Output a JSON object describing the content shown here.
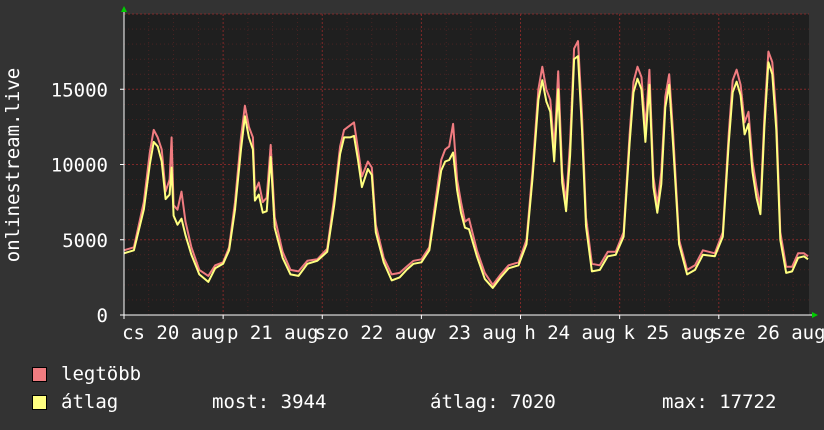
{
  "chart_data": {
    "type": "area",
    "ylabel": "onlinestream.live",
    "ylim": [
      0,
      20000
    ],
    "y_ticks": [
      "0",
      "5000",
      "10000",
      "15000"
    ],
    "x_tick_labels": [
      "cs 20 aug",
      "p 21 aug",
      "szo 22 aug",
      "v 23 aug",
      "h 24 aug",
      "k 25 aug",
      "sze 26 aug"
    ],
    "grid": true,
    "legend_placement": "bottom-left",
    "series": [
      {
        "name": "legtöbb",
        "color": "#f07c80",
        "points": [
          [
            0.0,
            4300
          ],
          [
            0.1,
            4500
          ],
          [
            0.2,
            7500
          ],
          [
            0.26,
            10800
          ],
          [
            0.3,
            12300
          ],
          [
            0.34,
            11800
          ],
          [
            0.38,
            11000
          ],
          [
            0.42,
            8200
          ],
          [
            0.46,
            9000
          ],
          [
            0.48,
            11800
          ],
          [
            0.5,
            7300
          ],
          [
            0.54,
            7000
          ],
          [
            0.58,
            8200
          ],
          [
            0.62,
            6200
          ],
          [
            0.68,
            4500
          ],
          [
            0.76,
            3000
          ],
          [
            0.85,
            2600
          ],
          [
            0.92,
            3300
          ],
          [
            1.0,
            3500
          ],
          [
            1.06,
            4500
          ],
          [
            1.12,
            7500
          ],
          [
            1.18,
            11800
          ],
          [
            1.22,
            13900
          ],
          [
            1.26,
            12500
          ],
          [
            1.3,
            11800
          ],
          [
            1.32,
            8200
          ],
          [
            1.36,
            8800
          ],
          [
            1.4,
            7500
          ],
          [
            1.44,
            7800
          ],
          [
            1.48,
            11300
          ],
          [
            1.52,
            6500
          ],
          [
            1.6,
            4200
          ],
          [
            1.68,
            3000
          ],
          [
            1.76,
            2900
          ],
          [
            1.85,
            3600
          ],
          [
            1.95,
            3700
          ],
          [
            2.05,
            4400
          ],
          [
            2.12,
            7800
          ],
          [
            2.18,
            11200
          ],
          [
            2.22,
            12300
          ],
          [
            2.28,
            12600
          ],
          [
            2.32,
            12800
          ],
          [
            2.36,
            11000
          ],
          [
            2.4,
            9200
          ],
          [
            2.46,
            10200
          ],
          [
            2.5,
            9800
          ],
          [
            2.54,
            6000
          ],
          [
            2.62,
            3800
          ],
          [
            2.7,
            2700
          ],
          [
            2.78,
            2800
          ],
          [
            2.85,
            3200
          ],
          [
            2.92,
            3600
          ],
          [
            3.0,
            3700
          ],
          [
            3.08,
            4500
          ],
          [
            3.14,
            7500
          ],
          [
            3.2,
            10300
          ],
          [
            3.24,
            11000
          ],
          [
            3.28,
            11200
          ],
          [
            3.32,
            12700
          ],
          [
            3.36,
            9000
          ],
          [
            3.4,
            7500
          ],
          [
            3.44,
            6200
          ],
          [
            3.48,
            6400
          ],
          [
            3.56,
            4300
          ],
          [
            3.64,
            2800
          ],
          [
            3.72,
            2000
          ],
          [
            3.8,
            2700
          ],
          [
            3.88,
            3300
          ],
          [
            3.98,
            3500
          ],
          [
            4.06,
            5000
          ],
          [
            4.12,
            9500
          ],
          [
            4.18,
            15000
          ],
          [
            4.22,
            16500
          ],
          [
            4.26,
            15000
          ],
          [
            4.3,
            14300
          ],
          [
            4.34,
            11000
          ],
          [
            4.38,
            16200
          ],
          [
            4.42,
            9500
          ],
          [
            4.46,
            7500
          ],
          [
            4.5,
            11500
          ],
          [
            4.54,
            17700
          ],
          [
            4.58,
            18200
          ],
          [
            4.62,
            13300
          ],
          [
            4.66,
            6500
          ],
          [
            4.72,
            3400
          ],
          [
            4.8,
            3300
          ],
          [
            4.88,
            4200
          ],
          [
            4.96,
            4200
          ],
          [
            5.04,
            5500
          ],
          [
            5.1,
            12000
          ],
          [
            5.14,
            15500
          ],
          [
            5.18,
            16500
          ],
          [
            5.22,
            15800
          ],
          [
            5.26,
            12400
          ],
          [
            5.3,
            16300
          ],
          [
            5.34,
            9200
          ],
          [
            5.38,
            7300
          ],
          [
            5.42,
            9500
          ],
          [
            5.46,
            14500
          ],
          [
            5.5,
            16000
          ],
          [
            5.54,
            12000
          ],
          [
            5.6,
            5000
          ],
          [
            5.68,
            3000
          ],
          [
            5.76,
            3300
          ],
          [
            5.84,
            4300
          ],
          [
            5.96,
            4100
          ],
          [
            6.04,
            5500
          ],
          [
            6.1,
            12000
          ],
          [
            6.14,
            15600
          ],
          [
            6.18,
            16300
          ],
          [
            6.22,
            15300
          ],
          [
            6.26,
            12800
          ],
          [
            6.3,
            13500
          ],
          [
            6.34,
            10200
          ],
          [
            6.38,
            8500
          ],
          [
            6.42,
            7200
          ],
          [
            6.46,
            13200
          ],
          [
            6.5,
            17500
          ],
          [
            6.54,
            16800
          ],
          [
            6.58,
            13200
          ],
          [
            6.62,
            5500
          ],
          [
            6.68,
            3200
          ],
          [
            6.74,
            3200
          ],
          [
            6.8,
            4100
          ],
          [
            6.86,
            4100
          ],
          [
            6.9,
            3900
          ]
        ]
      },
      {
        "name": "átlag",
        "color": "#ffff80",
        "points": [
          [
            0.0,
            4100
          ],
          [
            0.1,
            4300
          ],
          [
            0.2,
            7000
          ],
          [
            0.26,
            10000
          ],
          [
            0.3,
            11500
          ],
          [
            0.34,
            11200
          ],
          [
            0.38,
            10200
          ],
          [
            0.42,
            7700
          ],
          [
            0.46,
            8000
          ],
          [
            0.48,
            9800
          ],
          [
            0.5,
            6600
          ],
          [
            0.54,
            6000
          ],
          [
            0.58,
            6400
          ],
          [
            0.62,
            5300
          ],
          [
            0.68,
            4000
          ],
          [
            0.76,
            2700
          ],
          [
            0.85,
            2200
          ],
          [
            0.92,
            3100
          ],
          [
            1.0,
            3400
          ],
          [
            1.06,
            4300
          ],
          [
            1.12,
            7000
          ],
          [
            1.18,
            11000
          ],
          [
            1.22,
            13200
          ],
          [
            1.26,
            11800
          ],
          [
            1.3,
            11000
          ],
          [
            1.32,
            7600
          ],
          [
            1.36,
            8000
          ],
          [
            1.4,
            6800
          ],
          [
            1.44,
            6900
          ],
          [
            1.48,
            10500
          ],
          [
            1.52,
            5800
          ],
          [
            1.6,
            3800
          ],
          [
            1.68,
            2700
          ],
          [
            1.76,
            2600
          ],
          [
            1.85,
            3400
          ],
          [
            1.95,
            3600
          ],
          [
            2.05,
            4200
          ],
          [
            2.12,
            7300
          ],
          [
            2.18,
            10700
          ],
          [
            2.22,
            11800
          ],
          [
            2.28,
            11800
          ],
          [
            2.32,
            11900
          ],
          [
            2.36,
            10300
          ],
          [
            2.4,
            8500
          ],
          [
            2.46,
            9700
          ],
          [
            2.5,
            9300
          ],
          [
            2.54,
            5500
          ],
          [
            2.62,
            3500
          ],
          [
            2.7,
            2300
          ],
          [
            2.78,
            2500
          ],
          [
            2.85,
            3000
          ],
          [
            2.92,
            3400
          ],
          [
            3.0,
            3500
          ],
          [
            3.08,
            4300
          ],
          [
            3.14,
            7000
          ],
          [
            3.2,
            9600
          ],
          [
            3.24,
            10200
          ],
          [
            3.28,
            10300
          ],
          [
            3.32,
            10800
          ],
          [
            3.36,
            8300
          ],
          [
            3.4,
            6800
          ],
          [
            3.44,
            5800
          ],
          [
            3.48,
            5700
          ],
          [
            3.56,
            3900
          ],
          [
            3.64,
            2400
          ],
          [
            3.72,
            1800
          ],
          [
            3.8,
            2500
          ],
          [
            3.88,
            3100
          ],
          [
            3.98,
            3300
          ],
          [
            4.06,
            4700
          ],
          [
            4.12,
            9000
          ],
          [
            4.18,
            14300
          ],
          [
            4.22,
            15600
          ],
          [
            4.26,
            14200
          ],
          [
            4.3,
            13500
          ],
          [
            4.34,
            10200
          ],
          [
            4.38,
            15000
          ],
          [
            4.42,
            8800
          ],
          [
            4.46,
            6900
          ],
          [
            4.5,
            10600
          ],
          [
            4.54,
            17000
          ],
          [
            4.58,
            17200
          ],
          [
            4.62,
            12300
          ],
          [
            4.66,
            5900
          ],
          [
            4.72,
            2900
          ],
          [
            4.8,
            3000
          ],
          [
            4.88,
            3900
          ],
          [
            4.96,
            4000
          ],
          [
            5.04,
            5200
          ],
          [
            5.1,
            11400
          ],
          [
            5.14,
            14800
          ],
          [
            5.18,
            15700
          ],
          [
            5.22,
            15000
          ],
          [
            5.26,
            11500
          ],
          [
            5.3,
            15300
          ],
          [
            5.34,
            8500
          ],
          [
            5.38,
            6800
          ],
          [
            5.42,
            8700
          ],
          [
            5.46,
            13800
          ],
          [
            5.5,
            15300
          ],
          [
            5.54,
            11200
          ],
          [
            5.6,
            4700
          ],
          [
            5.68,
            2700
          ],
          [
            5.76,
            3000
          ],
          [
            5.84,
            4000
          ],
          [
            5.96,
            3900
          ],
          [
            6.04,
            5200
          ],
          [
            6.1,
            11400
          ],
          [
            6.14,
            14800
          ],
          [
            6.18,
            15500
          ],
          [
            6.22,
            14600
          ],
          [
            6.26,
            12000
          ],
          [
            6.3,
            12700
          ],
          [
            6.34,
            9500
          ],
          [
            6.38,
            7800
          ],
          [
            6.42,
            6700
          ],
          [
            6.46,
            12500
          ],
          [
            6.5,
            16800
          ],
          [
            6.54,
            16000
          ],
          [
            6.58,
            12300
          ],
          [
            6.62,
            5000
          ],
          [
            6.68,
            2800
          ],
          [
            6.74,
            2900
          ],
          [
            6.8,
            3800
          ],
          [
            6.86,
            3900
          ],
          [
            6.9,
            3700
          ]
        ]
      }
    ]
  },
  "stats": {
    "now": "most: 3944",
    "avg": "átlag: 7020",
    "max": "max: 17722"
  },
  "colors": {
    "background": "#333333",
    "plot_background": "#1f1f1f",
    "grid": "#8b2a2a",
    "axis": "#ffffff",
    "arrow": "#00cc00"
  }
}
